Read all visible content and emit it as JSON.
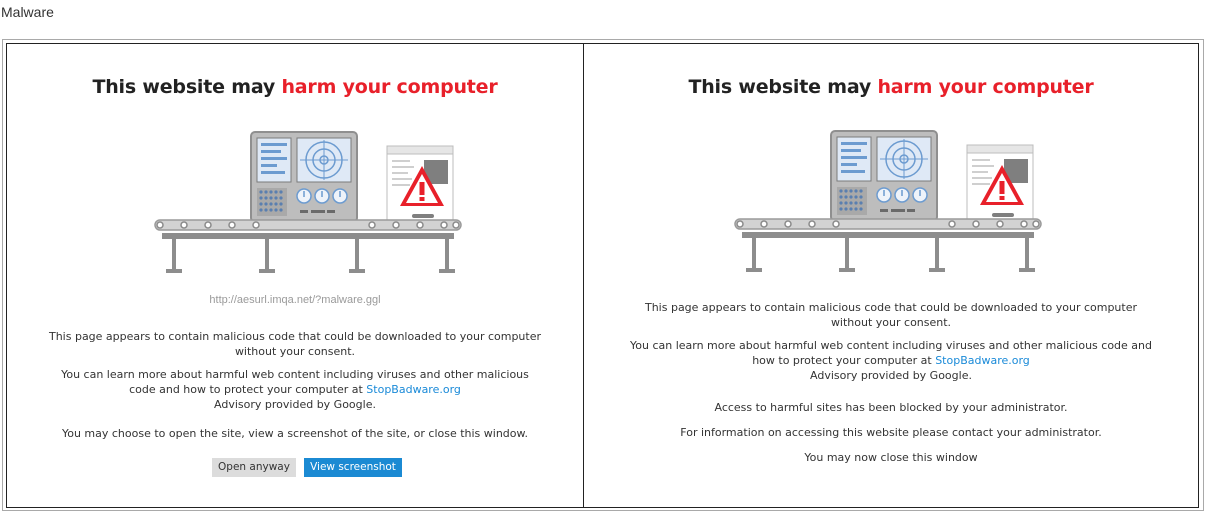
{
  "section_title": "Malware",
  "headline": {
    "prefix": "This website may ",
    "emphasis": "harm your computer"
  },
  "left_panel": {
    "url": "http://aesurl.imqa.net/?malware.ggl",
    "intro": "This page appears to contain malicious code that could be downloaded to your computer without your consent.",
    "learn_more": "You can learn more about harmful web content including viruses and other malicious code and how to protect your computer at",
    "learn_link": "StopBadware.org",
    "advisory": "Advisory provided by Google.",
    "choice": "You may choose to open the site, view a screenshot of the site, or close this window.",
    "open_button": "Open anyway",
    "screenshot_button": "View screenshot"
  },
  "right_panel": {
    "intro": "This page appears to contain malicious code that could be downloaded to your computer without your consent.",
    "learn_more": "You can learn more about harmful web content including viruses and other malicious code and how to protect your computer at",
    "learn_link": "StopBadware.org",
    "advisory": "Advisory provided by Google.",
    "blocked": "Access to harmful sites has been blocked by your administrator.",
    "contact": "For information on accessing this website please contact your administrator.",
    "close": "You may now close this window"
  },
  "colors": {
    "accent_red": "#e8202a",
    "link_blue": "#1a8ad8",
    "button_blue": "#1b8ad3",
    "button_grey": "#dcdcdc"
  },
  "icons": [
    "conveyor-scanner-illustration",
    "warning-triangle-icon"
  ]
}
